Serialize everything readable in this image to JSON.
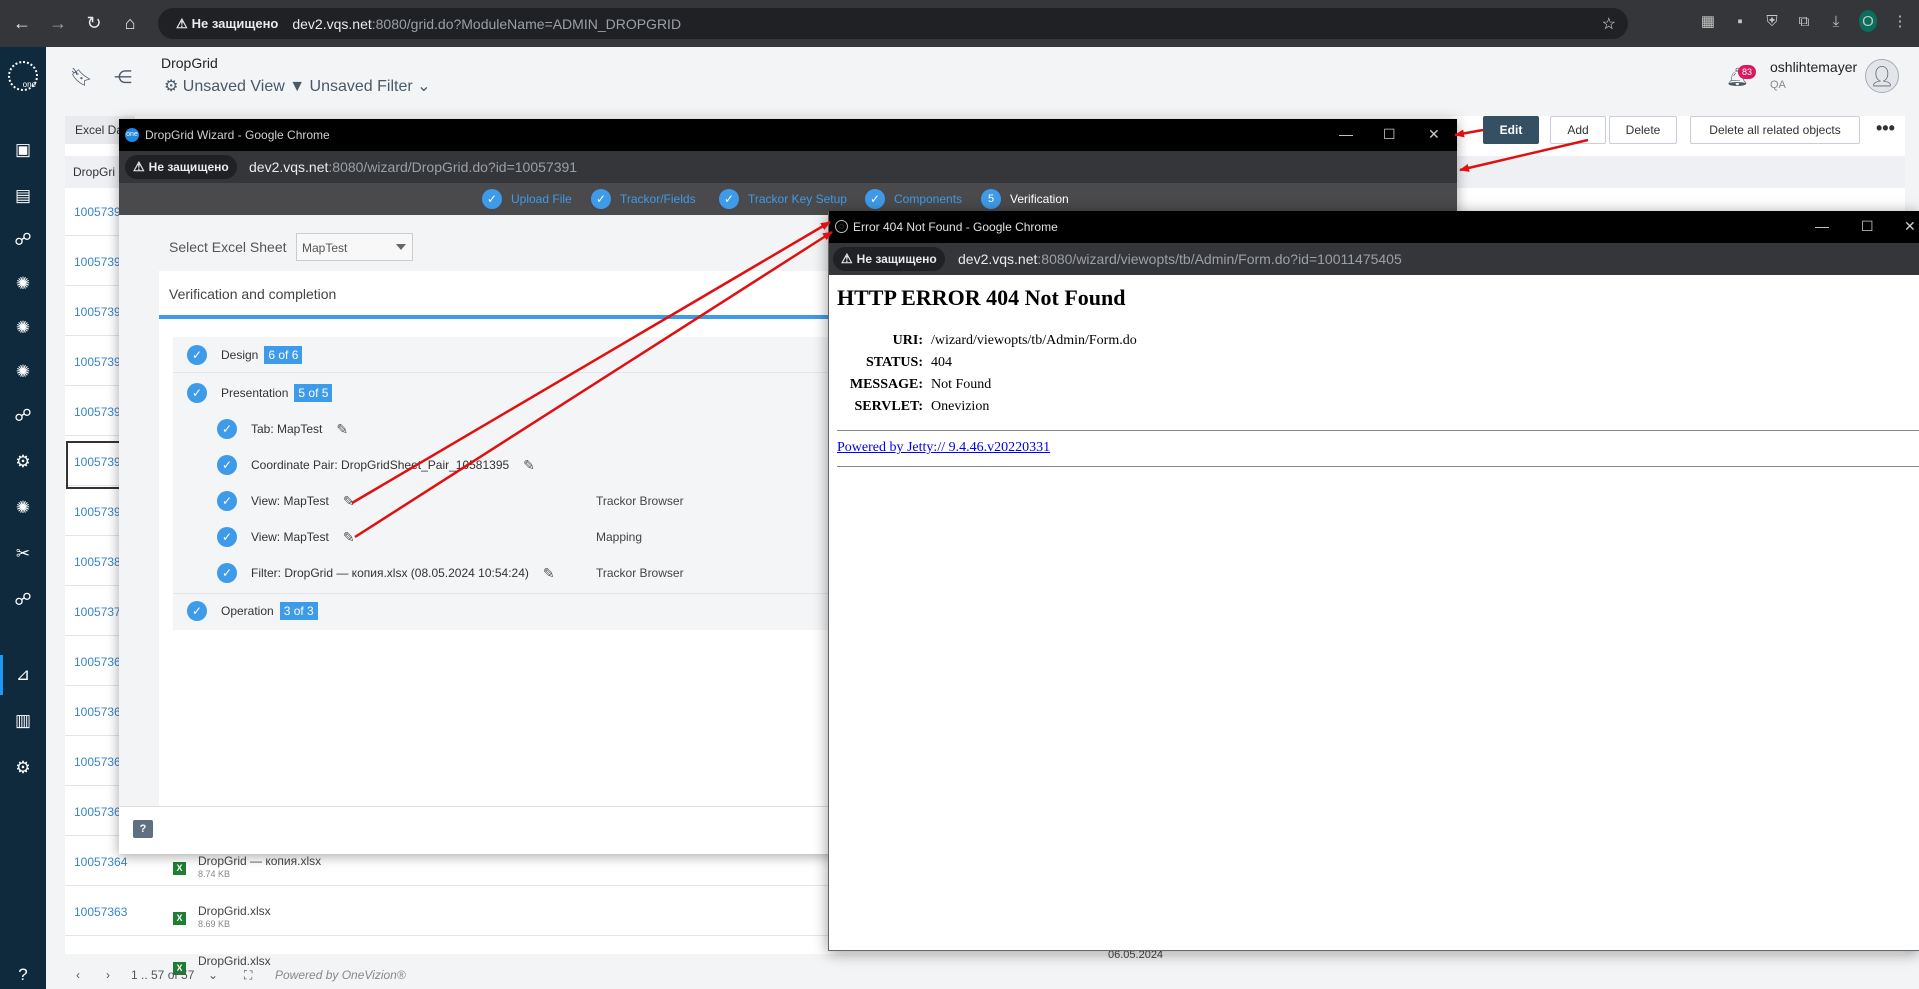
{
  "browser": {
    "security_label": "Не защищено",
    "url_host": "dev2.vqs.net",
    "url_rest": ":8080/grid.do?ModuleName=ADMIN_DROPGRID",
    "profile_initial": "O"
  },
  "header": {
    "page_title": "DropGrid",
    "view_label": "Unsaved View",
    "filter_label": "Unsaved Filter",
    "notifications_count": "83",
    "user_name": "oshlihtemayer",
    "user_role": "QA"
  },
  "toolbar": {
    "tab_label": "Excel Da",
    "edit_label": "Edit",
    "add_label": "Add",
    "delete_label": "Delete",
    "delete_related_label": "Delete all related objects"
  },
  "grid": {
    "column_header": "DropGri",
    "row_ids": [
      "1005739",
      "1005739",
      "1005739",
      "1005739",
      "1005739",
      "1005739",
      "1005739",
      "1005738",
      "1005737",
      "1005736",
      "1005736",
      "1005736",
      "1005736",
      "10057364",
      "10057363"
    ],
    "files": [
      {
        "name": "DropGrid — копия.xlsx",
        "size": "8.74 KB"
      },
      {
        "name": "DropGrid.xlsx",
        "size": "8.69 KB"
      },
      {
        "name": "DropGrid.xlsx",
        "size": ""
      }
    ],
    "bottom_date": "06.05.2024"
  },
  "pager": {
    "range": "1 .. 57 of 57",
    "powered": "Powered by OneVizion®"
  },
  "wizard": {
    "window_title": "DropGrid Wizard - Google Chrome",
    "url_host": "dev2.vqs.net",
    "url_rest": ":8080/wizard/DropGrid.do?id=10057391",
    "steps": [
      {
        "label": "Upload File",
        "mark": "✓"
      },
      {
        "label": "Trackor/Fields",
        "mark": "✓"
      },
      {
        "label": "Trackor Key Setup",
        "mark": "✓"
      },
      {
        "label": "Components",
        "mark": "✓"
      },
      {
        "label": "Verification",
        "mark": "5"
      }
    ],
    "sheet_label": "Select Excel Sheet",
    "sheet_value": "MapTest",
    "panel_title": "Verification and completion",
    "items": [
      {
        "label": "Design",
        "badge": "6 of 6"
      },
      {
        "label": "Presentation",
        "badge": "5 of 5"
      },
      {
        "label": "Tab: MapTest",
        "type": ""
      },
      {
        "label": "Coordinate Pair: DropGridSheet_Pair_10581395",
        "type": ""
      },
      {
        "label": "View: MapTest",
        "type": "Trackor Browser"
      },
      {
        "label": "View: MapTest",
        "type": "Mapping"
      },
      {
        "label": "Filter: DropGrid — копия.xlsx (08.05.2024 10:54:24)",
        "type": "Trackor Browser"
      },
      {
        "label": "Operation",
        "badge": "3 of 3"
      }
    ]
  },
  "error_window": {
    "window_title": "Error 404 Not Found - Google Chrome",
    "url_host": "dev2.vqs.net",
    "url_rest": ":8080/wizard/viewopts/tb/Admin/Form.do?id=10011475405",
    "heading": "HTTP ERROR 404 Not Found",
    "fields": [
      {
        "key": "URI:",
        "value": "/wizard/viewopts/tb/Admin/Form.do"
      },
      {
        "key": "STATUS:",
        "value": "404"
      },
      {
        "key": "MESSAGE:",
        "value": "Not Found"
      },
      {
        "key": "SERVLET:",
        "value": "Onevizion"
      }
    ],
    "footer_link": "Powered by Jetty:// 9.4.46.v20220331"
  },
  "colors": {
    "accent": "#3d9be9",
    "annotation_arrow": "#e01010",
    "sidebar": "#0f2a3d",
    "edit_button": "#355062"
  }
}
